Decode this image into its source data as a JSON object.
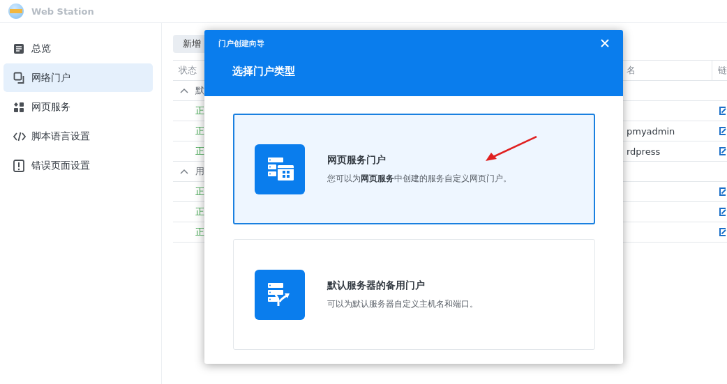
{
  "app": {
    "title": "Web Station"
  },
  "sidebar": {
    "items": [
      {
        "label": "总览",
        "selected": false
      },
      {
        "label": "网络门户",
        "selected": true
      },
      {
        "label": "网页服务",
        "selected": false
      },
      {
        "label": "脚本语言设置",
        "selected": false
      },
      {
        "label": "错误页面设置",
        "selected": false
      }
    ]
  },
  "toolbar": {
    "buttons": [
      "新增"
    ]
  },
  "table": {
    "columns": [
      "状态",
      "名",
      "链"
    ],
    "groups": [
      {
        "label": "默",
        "expanded": true,
        "rows": [
          {
            "status": "正"
          },
          {
            "status": "正",
            "name": "pmyadmin"
          },
          {
            "status": "正",
            "name": "rdpress"
          }
        ]
      },
      {
        "label": "用",
        "expanded": true,
        "rows": [
          {
            "status": "正"
          },
          {
            "status": "正"
          },
          {
            "status": "正"
          }
        ]
      }
    ]
  },
  "dialog": {
    "title": "门户创建向导",
    "heading": "选择门户类型",
    "options": [
      {
        "title": "网页服务门户",
        "description": "您可以为**网页服务**中创建的服务自定义网页门户。",
        "selected": true
      },
      {
        "title": "默认服务器的备用门户",
        "description": "可以为默认服务器自定义主机名和端口。",
        "selected": false
      }
    ]
  }
}
